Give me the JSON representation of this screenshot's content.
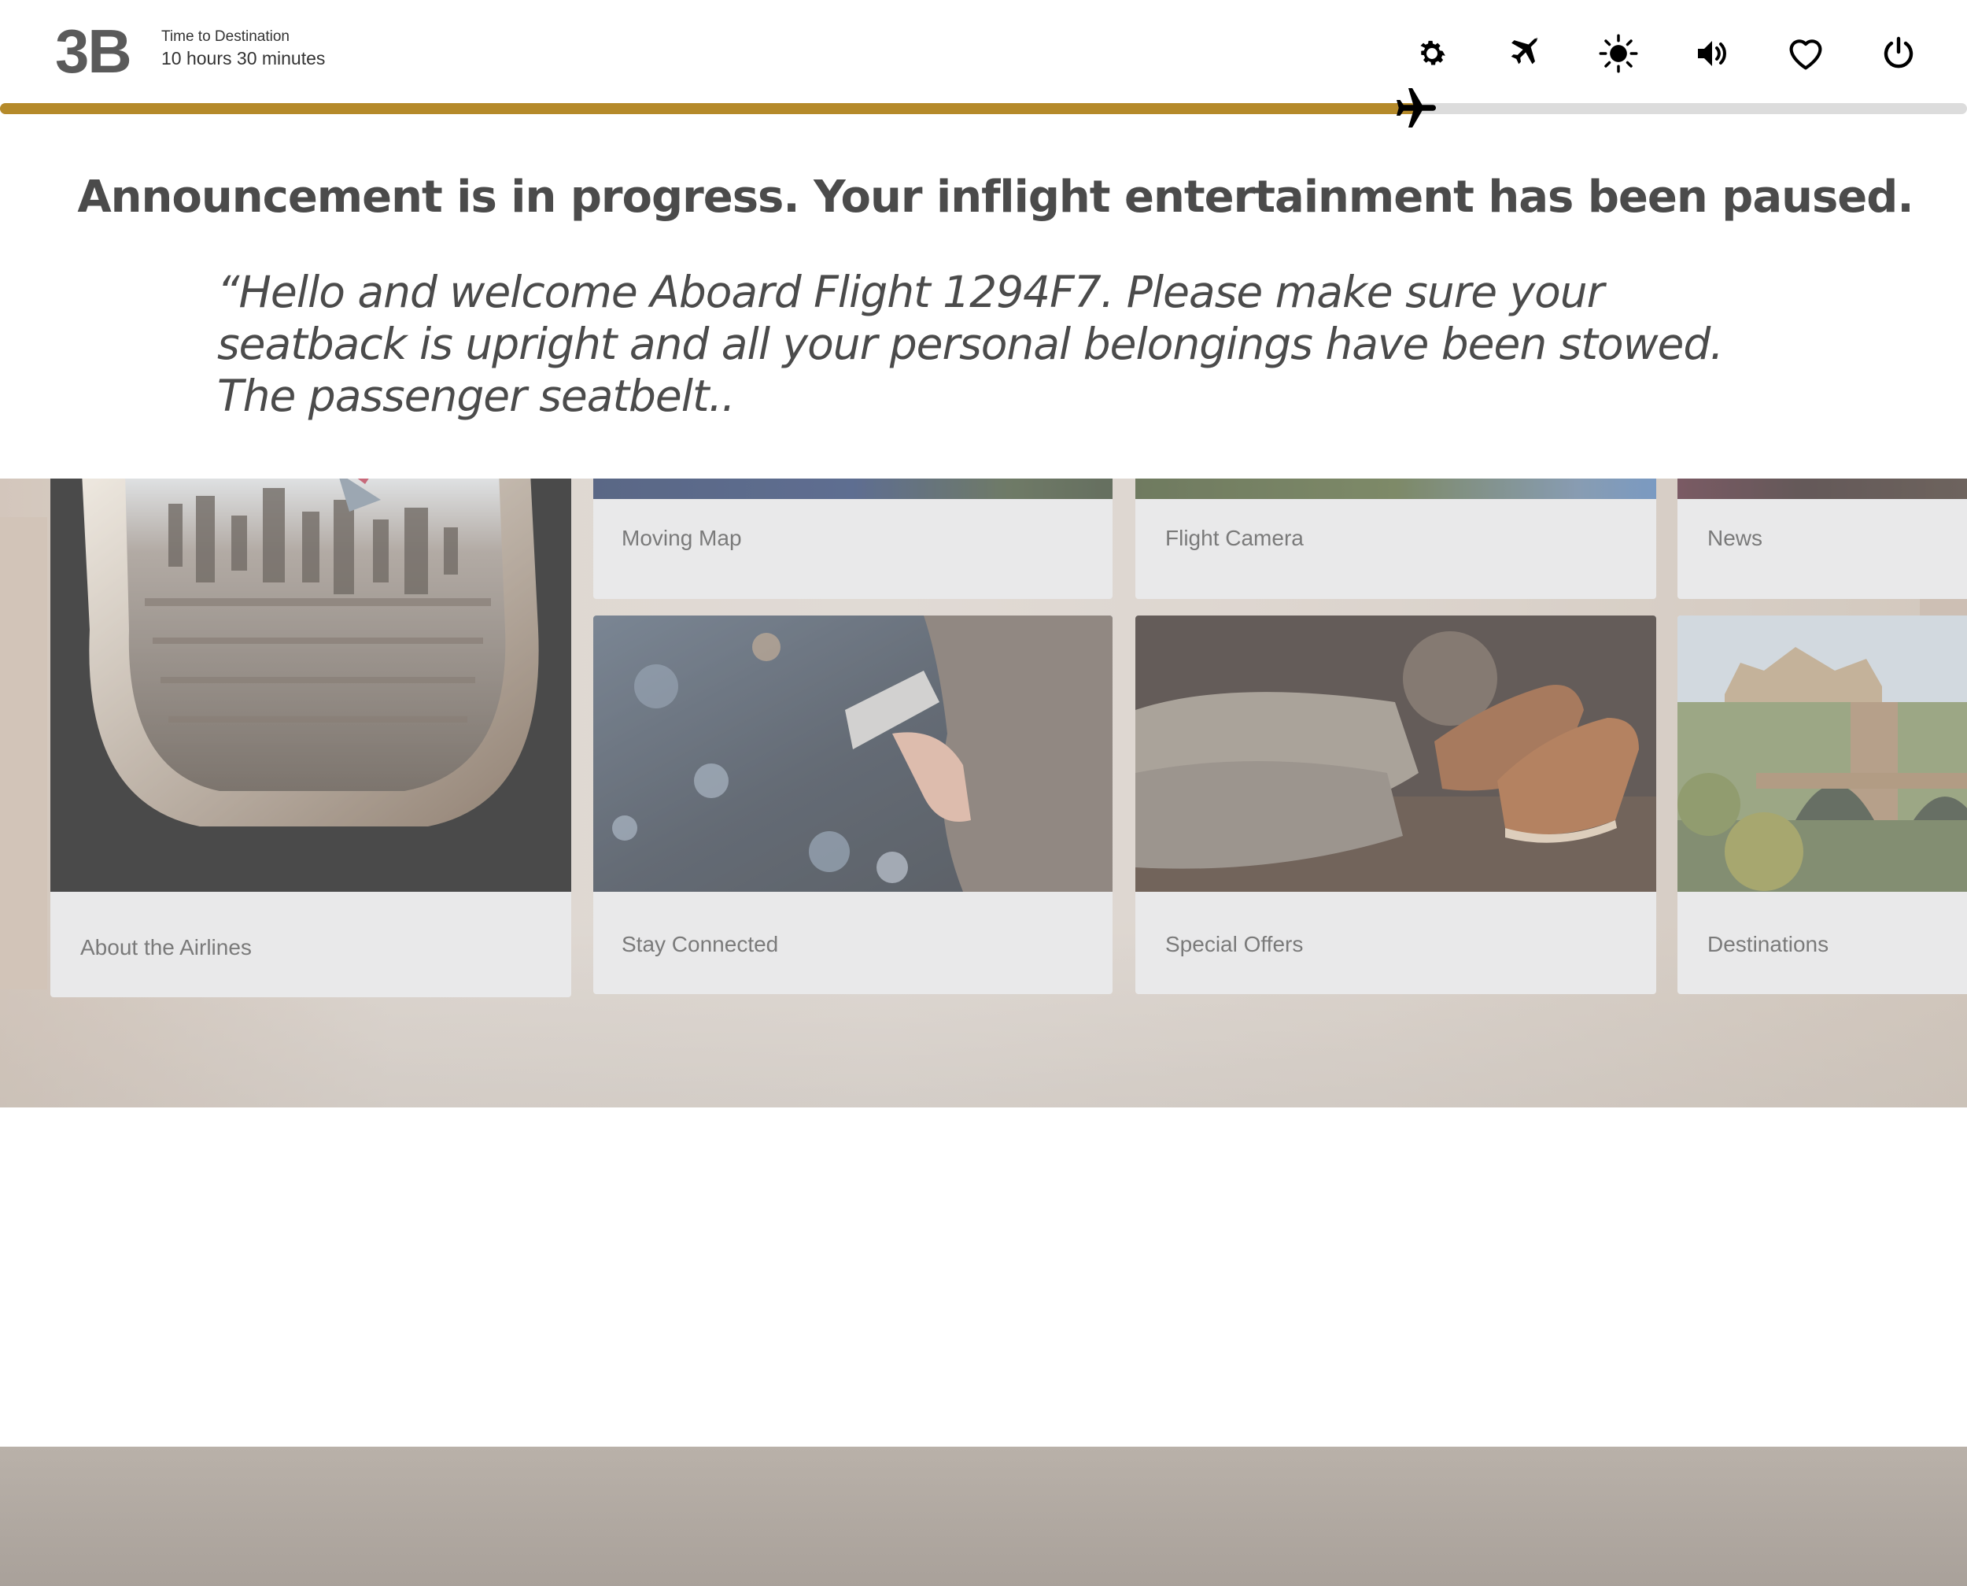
{
  "header": {
    "seat": "3B",
    "time_to_destination_label": "Time to Destination",
    "time_to_destination_value": "10 hours 30 minutes"
  },
  "toolbar": {
    "icons": [
      "gear-icon",
      "airplane-icon",
      "brightness-icon",
      "volume-icon",
      "heart-icon",
      "power-icon"
    ]
  },
  "flight_progress": {
    "fraction": 0.72,
    "fill_color": "#b58a2a",
    "track_color": "#dcdcdc"
  },
  "announcement": {
    "title": "Announcement is in progress. Your inflight entertainment has been paused.",
    "message": "“Hello and welcome Aboard Flight 1294F7. Please make sure your seatback is upright and all your personal belongings have been stowed. The passenger seatbelt.."
  },
  "tiles": {
    "moving_map": "Moving Map",
    "flight_camera": "Flight Camera",
    "news": "News",
    "about_airlines": "About the Airlines",
    "stay_connected": "Stay Connected",
    "special_offers": "Special Offers",
    "destinations": "Destinations"
  }
}
